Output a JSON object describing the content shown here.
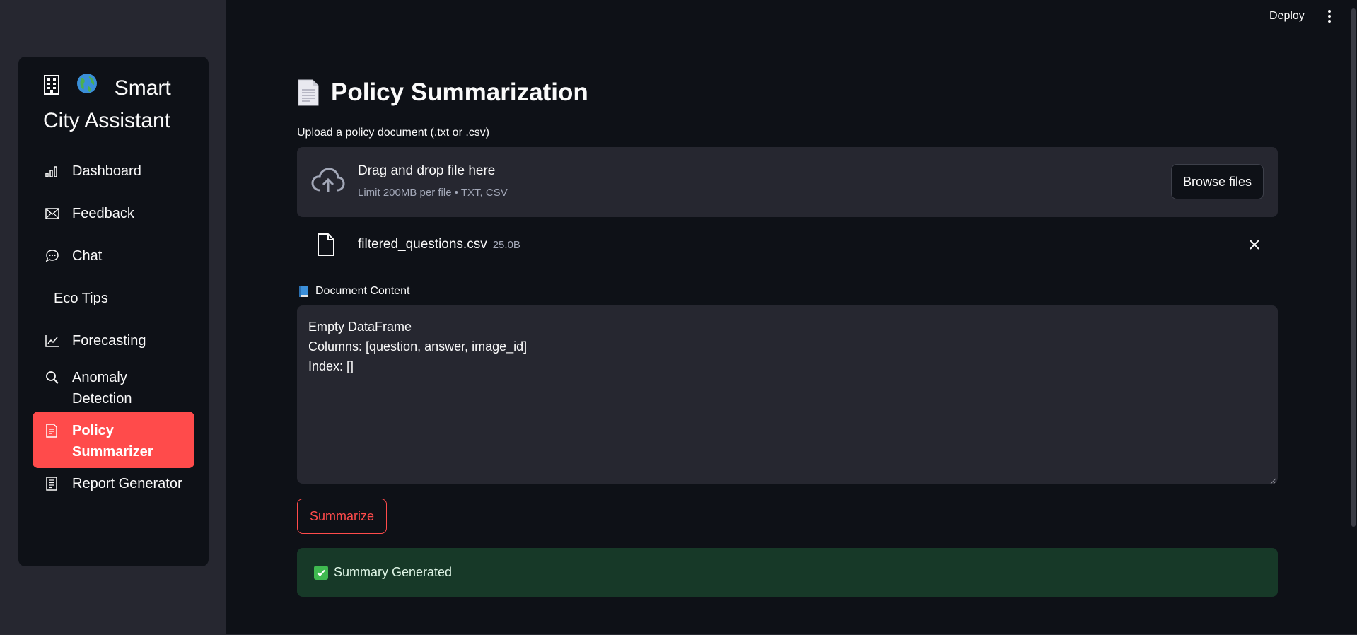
{
  "app": {
    "title": "Smart City Assistant",
    "title_icons": [
      "building-icon",
      "globe-icon"
    ]
  },
  "header": {
    "deploy_label": "Deploy",
    "menu_icon": "kebab-menu-icon"
  },
  "sidebar": {
    "items": [
      {
        "label": "Dashboard",
        "icon": "bar-chart-icon",
        "active": false
      },
      {
        "label": "Feedback",
        "icon": "envelope-icon",
        "active": false
      },
      {
        "label": "Chat",
        "icon": "chat-bubble-icon",
        "active": false
      },
      {
        "label": "Eco Tips",
        "icon": "",
        "active": false
      },
      {
        "label": "Forecasting",
        "icon": "line-chart-icon",
        "active": false
      },
      {
        "label": "Anomaly Detection",
        "icon": "search-icon",
        "active": false
      },
      {
        "label": "Policy Summarizer",
        "icon": "document-icon",
        "active": true
      },
      {
        "label": "Report Generator",
        "icon": "ledger-icon",
        "active": false
      }
    ]
  },
  "main": {
    "title": "Policy Summarization",
    "title_icon": "page-icon",
    "upload": {
      "label": "Upload a policy document (.txt or .csv)",
      "drop_text": "Drag and drop file here",
      "limit_text": "Limit 200MB per file • TXT, CSV",
      "browse_label": "Browse files"
    },
    "file": {
      "name": "filtered_questions.csv",
      "size": "25.0B"
    },
    "document": {
      "label": "Document Content",
      "content": "Empty DataFrame\nColumns: [question, answer, image_id]\nIndex: []"
    },
    "summarize_label": "Summarize",
    "success_text": "Summary Generated"
  },
  "colors": {
    "background": "#0e1117",
    "sidebar": "#262730",
    "accent": "#ff4b4b",
    "success_bg": "#173928",
    "success_icon": "#3fb950"
  }
}
